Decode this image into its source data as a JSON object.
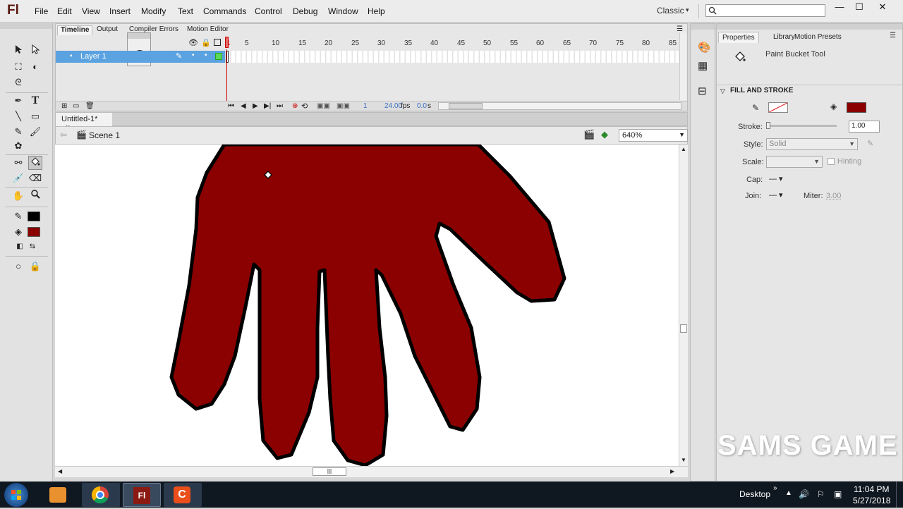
{
  "app": {
    "logo": "Fl",
    "menu": [
      "File",
      "Edit",
      "View",
      "Insert",
      "Modify",
      "Text",
      "Commands",
      "Control",
      "Debug",
      "Window",
      "Help"
    ],
    "workspace": "Classic",
    "window_controls": {
      "minimize": "—",
      "maximize": "☐",
      "close": "✕"
    }
  },
  "timeline": {
    "tabs": [
      "Timeline",
      "Output",
      "Compiler Errors",
      "Motion Editor"
    ],
    "frame_numbers": [
      "1",
      "5",
      "10",
      "15",
      "20",
      "25",
      "30",
      "35",
      "40",
      "45",
      "50",
      "55",
      "60",
      "65",
      "70",
      "75",
      "80",
      "85"
    ],
    "layer_name": "Layer 1",
    "current_frame": "1",
    "fps": "24.00",
    "fps_unit": "fps",
    "time": "0.0",
    "time_unit": "s"
  },
  "document": {
    "tab_title": "Untitled-1*",
    "tab_close": "×",
    "scene": "Scene 1",
    "zoom": "640%"
  },
  "properties": {
    "tabs": [
      "Properties",
      "Library",
      "Motion Presets"
    ],
    "tool_name": "Paint Bucket Tool",
    "section": "FILL AND STROKE",
    "stroke_label": "Stroke:",
    "stroke_value": "1.00",
    "style_label": "Style:",
    "style_value": "Solid",
    "scale_label": "Scale:",
    "hinting_label": "Hinting",
    "cap_label": "Cap:",
    "join_label": "Join:",
    "miter_label": "Miter:",
    "miter_value": "3.00"
  },
  "colors": {
    "fill": "#8b0000",
    "stroke_swatch": "#000000",
    "layer_highlight": "#5aa2e0"
  },
  "watermark": "SAMS GAME",
  "taskbar": {
    "desktop_label": "Desktop",
    "time": "11:04 PM",
    "date": "5/27/2018"
  }
}
